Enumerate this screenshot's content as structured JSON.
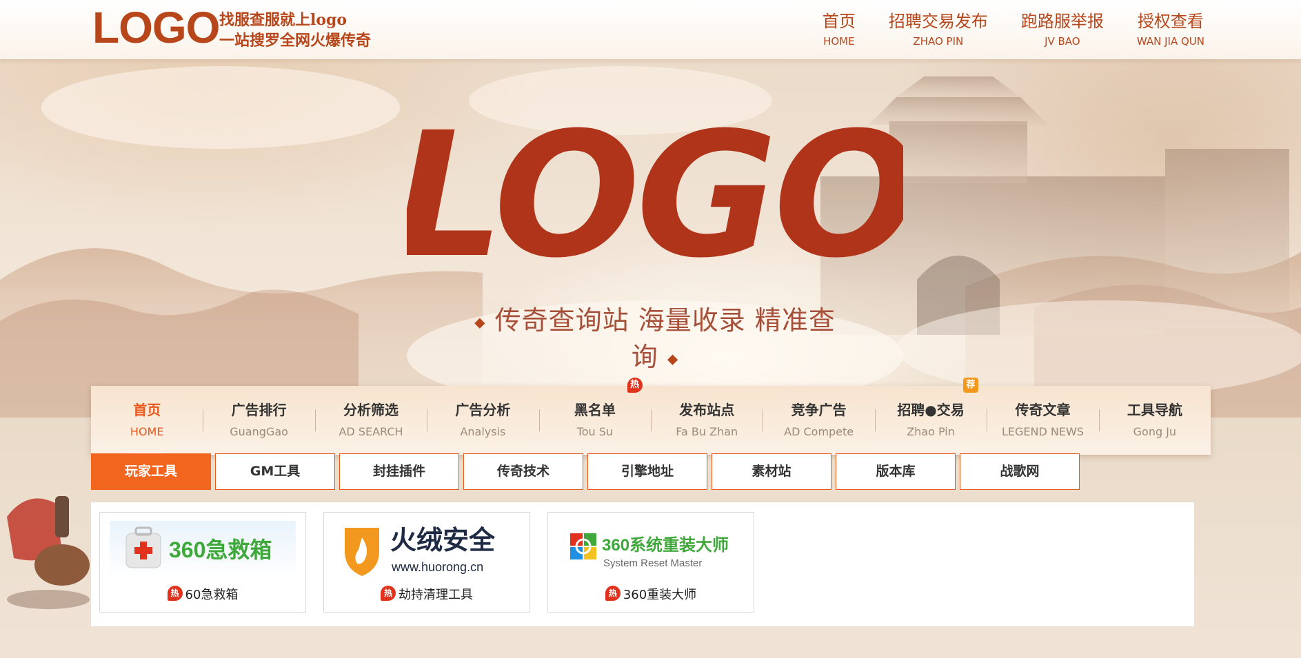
{
  "header": {
    "logo_text": "LOGO",
    "slogan_line1": "找服查服就上logo",
    "slogan_line2": "一站搜罗全网火爆传奇",
    "nav": [
      {
        "cn": "首页",
        "en": "HOME"
      },
      {
        "cn": "招聘交易发布",
        "en": "ZHAO PIN"
      },
      {
        "cn": "跑路服举报",
        "en": "JV BAO"
      },
      {
        "cn": "授权查看",
        "en": "WAN JIA QUN"
      }
    ]
  },
  "hero": {
    "logo_text": "LOGO",
    "tagline": "传奇查询站  海量收录  精准查询"
  },
  "main_nav": [
    {
      "cn": "首页",
      "en": "HOME",
      "active": true
    },
    {
      "cn": "广告排行",
      "en": "GuangGao"
    },
    {
      "cn": "分析筛选",
      "en": "AD SEARCH"
    },
    {
      "cn": "广告分析",
      "en": "Analysis"
    },
    {
      "cn": "黑名单",
      "en": "Tou Su",
      "badge": "热"
    },
    {
      "cn": "发布站点",
      "en": "Fa Bu Zhan"
    },
    {
      "cn": "竞争广告",
      "en": "AD Compete"
    },
    {
      "cn": "招聘●交易",
      "en": "Zhao Pin",
      "badge": "荐"
    },
    {
      "cn": "传奇文章",
      "en": "LEGEND NEWS"
    },
    {
      "cn": "工具导航",
      "en": "Gong Ju"
    }
  ],
  "sub_tabs": [
    "玩家工具",
    "GM工具",
    "封挂插件",
    "传奇技术",
    "引擎地址",
    "素材站",
    "版本库",
    "战歌网"
  ],
  "tools": [
    {
      "logo_text": "360急救箱",
      "label": "60急救箱",
      "hot": "热"
    },
    {
      "logo_text": "火绒安全",
      "logo_sub": "www.huorong.cn",
      "label": "劫持清理工具",
      "hot": "热"
    },
    {
      "logo_text": "360系统重装大师",
      "logo_sub": "System Reset Master",
      "label": "360重装大师",
      "hot": "热"
    }
  ],
  "colors": {
    "brand": "#b8461b",
    "accent": "#f2651f",
    "hot": "#e0321c",
    "recommend": "#f39a1e"
  }
}
